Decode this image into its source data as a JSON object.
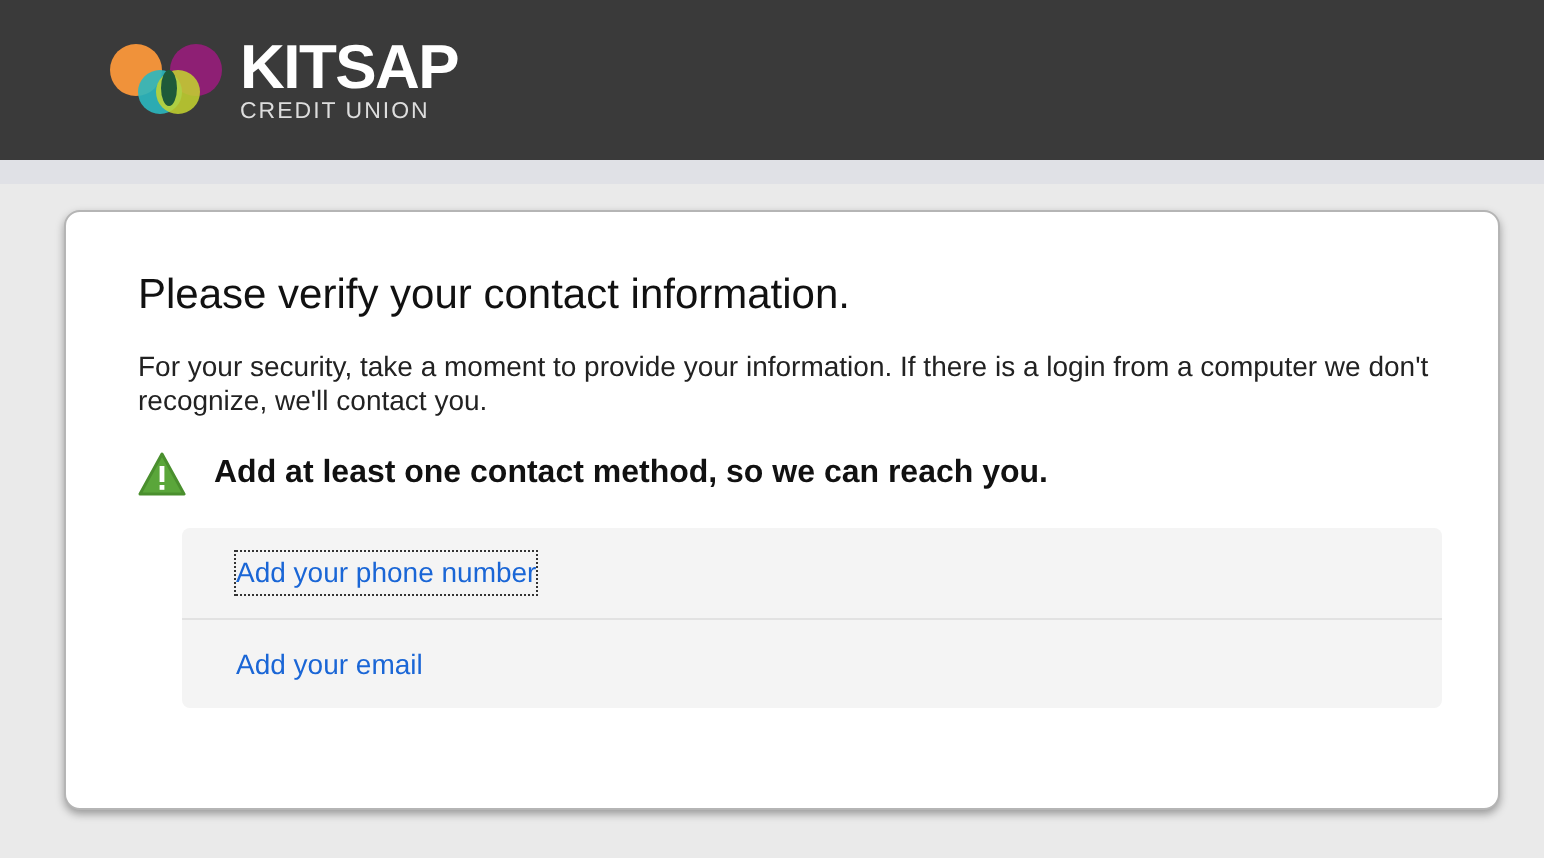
{
  "header": {
    "logo": {
      "name": "KITSAP",
      "tagline": "CREDIT UNION"
    }
  },
  "dialog": {
    "title": "Please verify your contact information.",
    "message": "For your security, take a moment to provide your information. If there is a login from a computer we don't recognize, we'll contact you.",
    "alert": {
      "kind": "warning",
      "text": "Add at least one contact method, so we can reach you."
    },
    "options": [
      {
        "label": "Add your phone number",
        "focused": true
      },
      {
        "label": "Add your email",
        "focused": false
      }
    ]
  }
}
